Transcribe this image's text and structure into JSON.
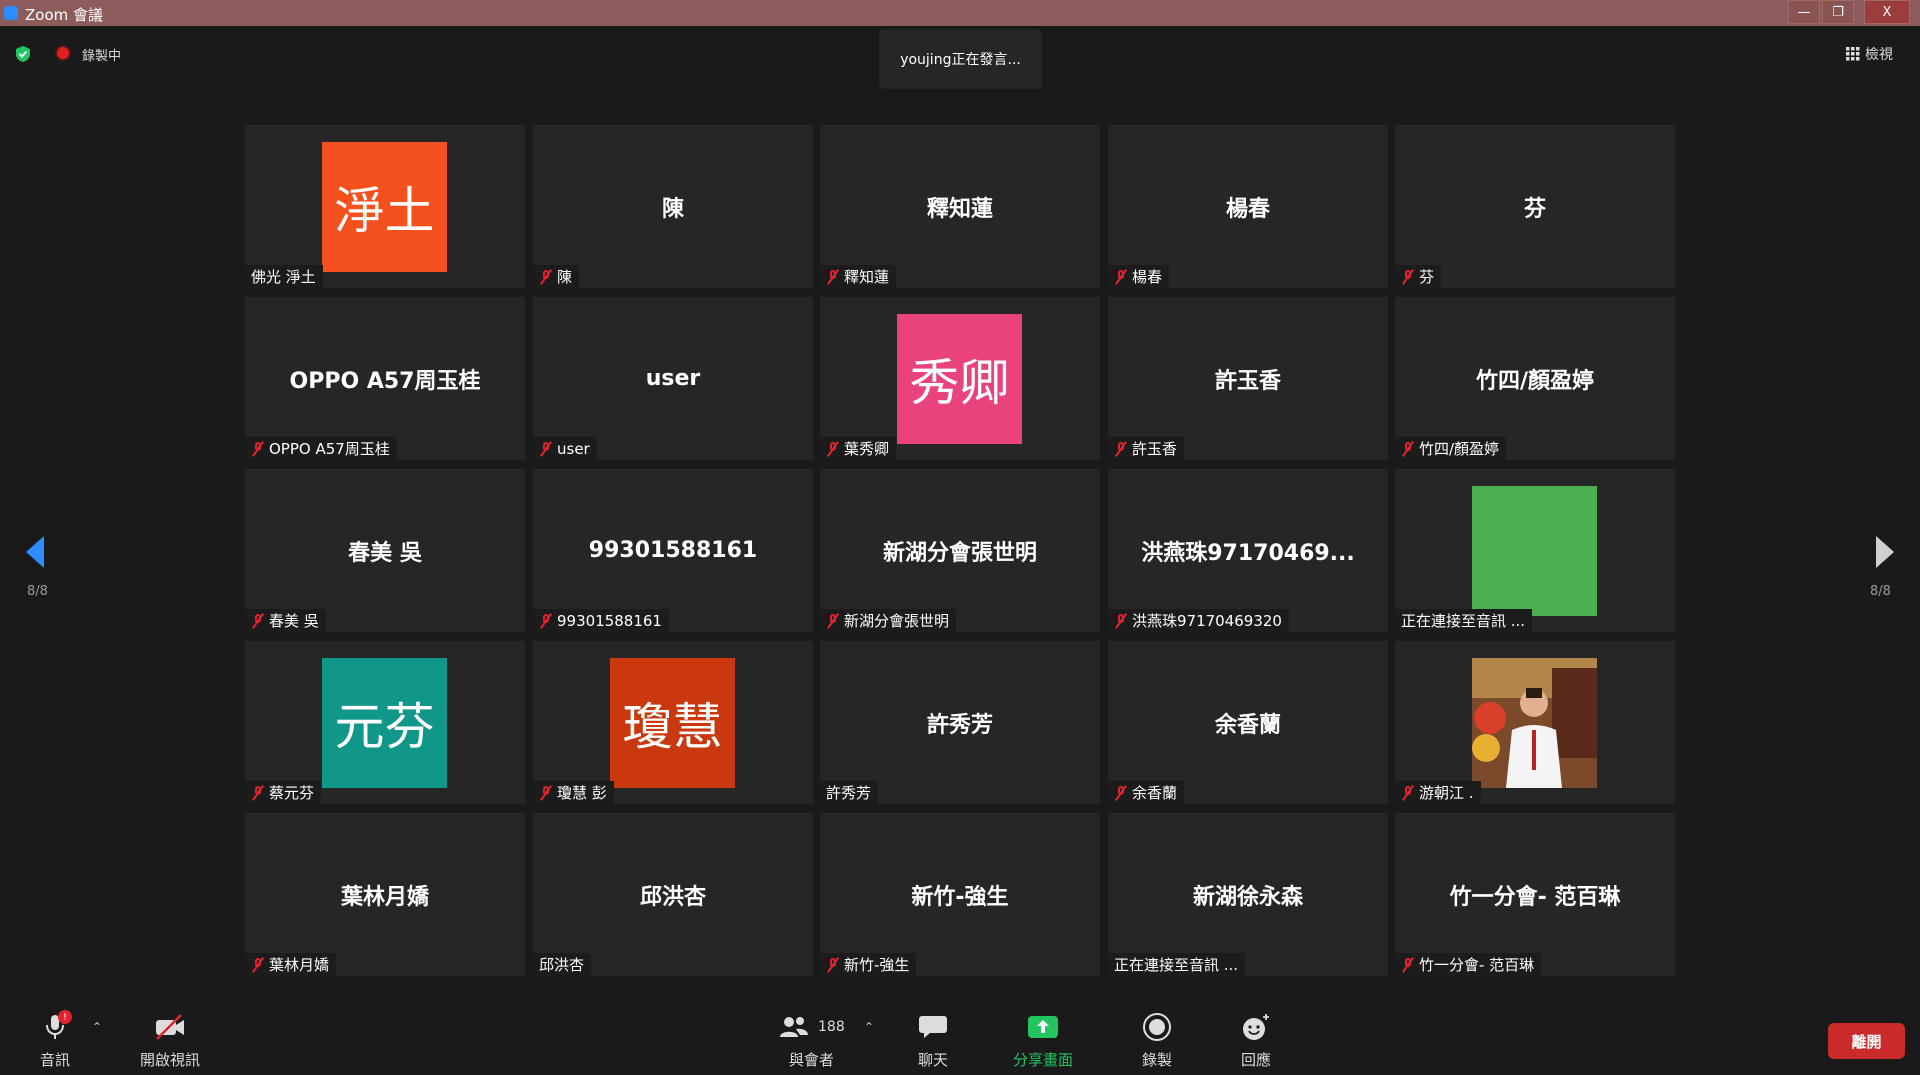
{
  "window": {
    "title": "Zoom 會議",
    "minimize": "—",
    "restore": "❐",
    "close": "X"
  },
  "status": {
    "recording_label": "錄製中",
    "speaking_text": "youjing正在發言...",
    "view_label": "檢視"
  },
  "pagination": {
    "left": "8/8",
    "right": "8/8"
  },
  "colors": {
    "accent": "#2d8cff",
    "mute_red": "#e0242f",
    "share_green": "#22c55e",
    "leave_red": "#c92a2a"
  },
  "tiles": [
    {
      "avatar_text": "淨土",
      "avatar_color": "#f4511e",
      "label": "佛光 淨土",
      "muted": false
    },
    {
      "center_text": "陳",
      "label": "陳",
      "muted": true
    },
    {
      "center_text": "釋知蓮",
      "label": "釋知蓮",
      "muted": true
    },
    {
      "center_text": "楊春",
      "label": "楊春",
      "muted": true
    },
    {
      "center_text": "芬",
      "label": "芬",
      "muted": true
    },
    {
      "center_text": "OPPO A57周玉桂",
      "label": "OPPO A57周玉桂",
      "muted": true
    },
    {
      "center_text": "user",
      "label": "user",
      "muted": true
    },
    {
      "avatar_text": "秀卿",
      "avatar_color": "#e8437d",
      "label": "葉秀卿",
      "muted": true
    },
    {
      "center_text": "許玉香",
      "label": "許玉香",
      "muted": true
    },
    {
      "center_text": "竹四/顏盈婷",
      "label": "竹四/顏盈婷",
      "muted": true
    },
    {
      "center_text": "春美 吳",
      "label": "春美 吳",
      "muted": true
    },
    {
      "center_text": "99301588161",
      "label": "99301588161",
      "muted": true
    },
    {
      "center_text": "新湖分會張世明",
      "label": "新湖分會張世明",
      "muted": true
    },
    {
      "center_text": "洪燕珠97170469...",
      "label": "洪燕珠97170469320",
      "muted": true
    },
    {
      "avatar_text": "",
      "avatar_color": "#4caf50",
      "label": "正在連接至音訊 ...",
      "muted": false
    },
    {
      "avatar_text": "元芬",
      "avatar_color": "#11978a",
      "label": "蔡元芬",
      "muted": true
    },
    {
      "avatar_text": "瓊慧",
      "avatar_color": "#c9380f",
      "label": "瓊慧 彭",
      "muted": true
    },
    {
      "center_text": "許秀芳",
      "label": "許秀芳",
      "muted": false
    },
    {
      "center_text": "余香蘭",
      "label": "余香蘭",
      "muted": true
    },
    {
      "photo": true,
      "label": "游朝江 .",
      "muted": true
    },
    {
      "center_text": "葉林月嬌",
      "label": "葉林月嬌",
      "muted": true
    },
    {
      "center_text": "邱洪杏",
      "label": "邱洪杏",
      "muted": false
    },
    {
      "center_text": "新竹-強生",
      "label": "新竹-強生",
      "muted": true
    },
    {
      "center_text": "新湖徐永森",
      "label": "正在連接至音訊 ...",
      "muted": false
    },
    {
      "center_text": "竹一分會- 范百琳",
      "label": "竹一分會- 范百琳",
      "muted": true
    }
  ],
  "toolbar": {
    "audio": "音訊",
    "video": "開啟視訊",
    "participants": "與會者",
    "participants_count": "188",
    "chat": "聊天",
    "share": "分享畫面",
    "record": "錄製",
    "reactions": "回應",
    "leave": "離開",
    "audio_alert": "!"
  }
}
